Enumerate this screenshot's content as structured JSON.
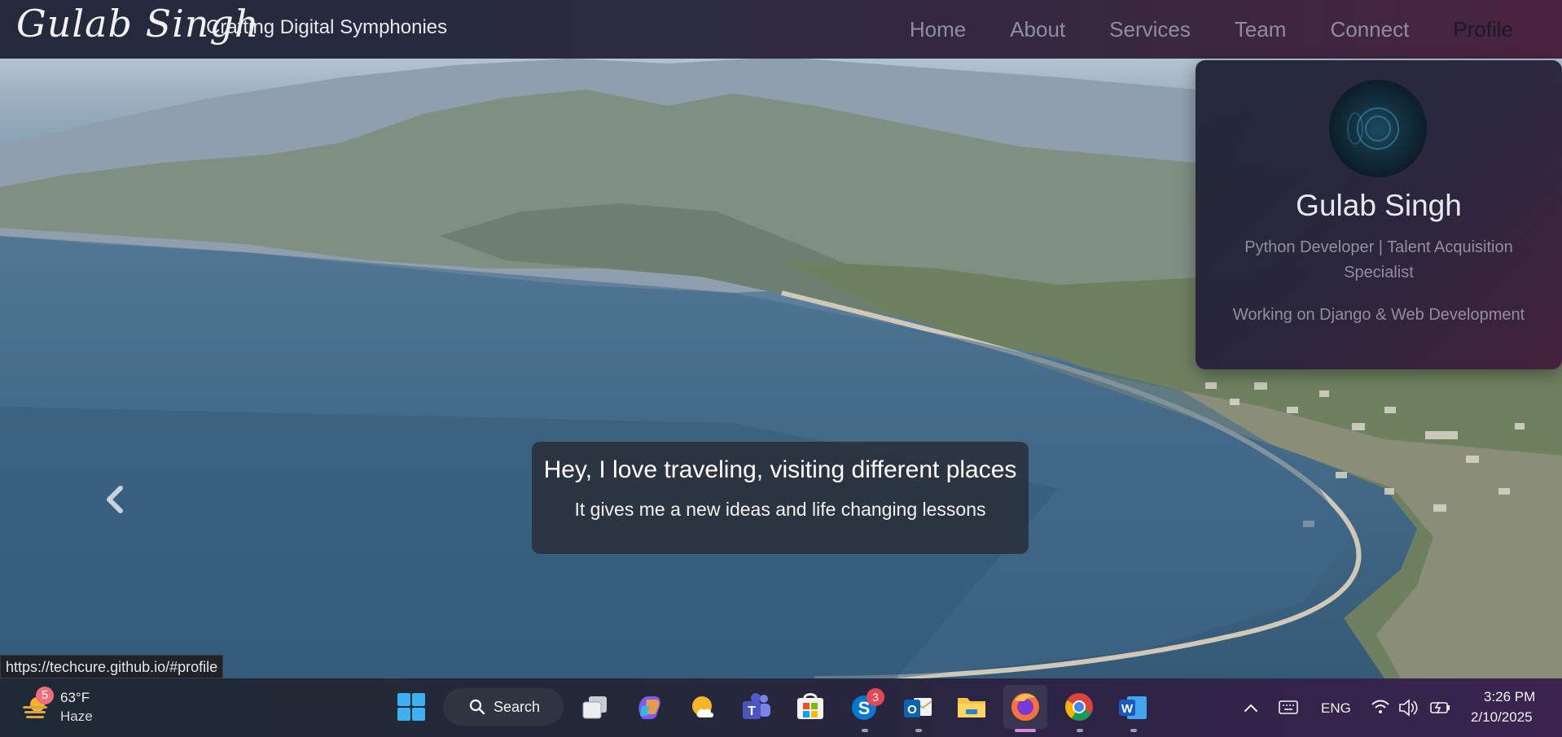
{
  "navbar": {
    "brand": "Gulab Singh",
    "tagline": "Crafting Digital Symphonies",
    "links": [
      "Home",
      "About",
      "Services",
      "Team",
      "Connect",
      "Profile"
    ]
  },
  "profile": {
    "name": "Gulab Singh",
    "role": "Python Developer | Talent Acquisition Specialist",
    "status": "Working on Django & Web Development"
  },
  "hero": {
    "caption_title": "Hey, I love traveling, visiting different places",
    "caption_subtitle": "It gives me a new ideas and life changing lessons"
  },
  "status_bar": {
    "url": "https://techcure.github.io/#profile"
  },
  "taskbar": {
    "weather": {
      "badge": "5",
      "temp": "63°F",
      "condition": "Haze"
    },
    "search_label": "Search",
    "skype_badge": "3",
    "tray": {
      "language": "ENG"
    },
    "clock": {
      "time": "3:26 PM",
      "date": "2/10/2025"
    }
  },
  "colors": {
    "navbar_start": "#232a3b",
    "navbar_end": "#4a2340",
    "accent_badge": "#e74856"
  }
}
